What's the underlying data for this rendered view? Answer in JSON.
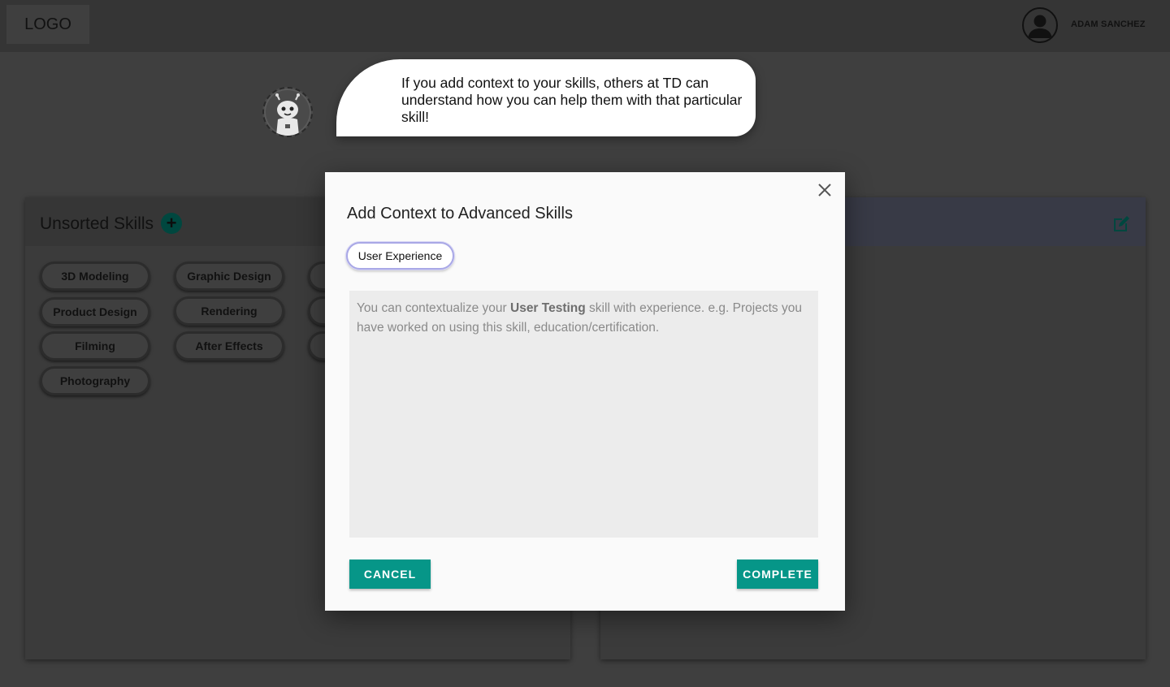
{
  "header": {
    "logo_text": "LOGO",
    "user_name": "ADAM SANCHEZ"
  },
  "assistant": {
    "message": "If you add context to your skills, others at TD can understand how you can help them with that particular skill!"
  },
  "left_panel": {
    "title": "Unsorted Skills",
    "chips": [
      "3D Modeling",
      "Graphic Design",
      "Product Design",
      "Rendering",
      "Filming",
      "After Effects",
      "Photography"
    ]
  },
  "modal": {
    "title": "Add Context to Advanced Skills",
    "selected_skill": "User Experience",
    "placeholder_prefix": "You can contextualize your ",
    "placeholder_skill": "User Testing",
    "placeholder_suffix": " skill with experience. e.g. Projects you have worked on using this skill, education/certification.",
    "cancel_label": "CANCEL",
    "complete_label": "COMPLETE"
  },
  "colors": {
    "accent": "#069688",
    "overlay_bg": "#3f3f3f",
    "pill_border": "#a9a8e6"
  }
}
